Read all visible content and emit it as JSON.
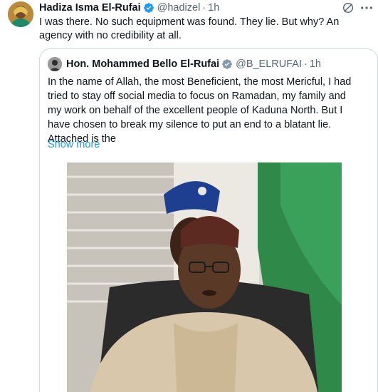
{
  "tweet": {
    "author_name": "Hadiza Isma El-Rufai",
    "handle": "@hadizel",
    "separator": "·",
    "time": "1h",
    "text": "I was there. No such equipment was found. They lie. But why? An agency with no credibility at all."
  },
  "quote": {
    "author_name": "Hon. Mohammed Bello El-Rufai",
    "handle": "@B_ELRUFAI",
    "separator": "·",
    "time": "1h",
    "text": "In the name of Allah, the most Beneficient, the most Mericful, I had tried to stay off social media to focus on Ramadan, my family and my work on behalf of the excellent people of Kaduna North. But I have chosen to break my silence to put an end to a blatant lie. Attached is the",
    "show_more": "Show more"
  },
  "colors": {
    "verified_blue": "#1d9bf0",
    "secondary_text": "#536471",
    "link": "#1d9bf0",
    "border": "#cfd9de"
  },
  "icons": [
    "verified-badge-icon",
    "grok-icon",
    "more-options-icon"
  ]
}
